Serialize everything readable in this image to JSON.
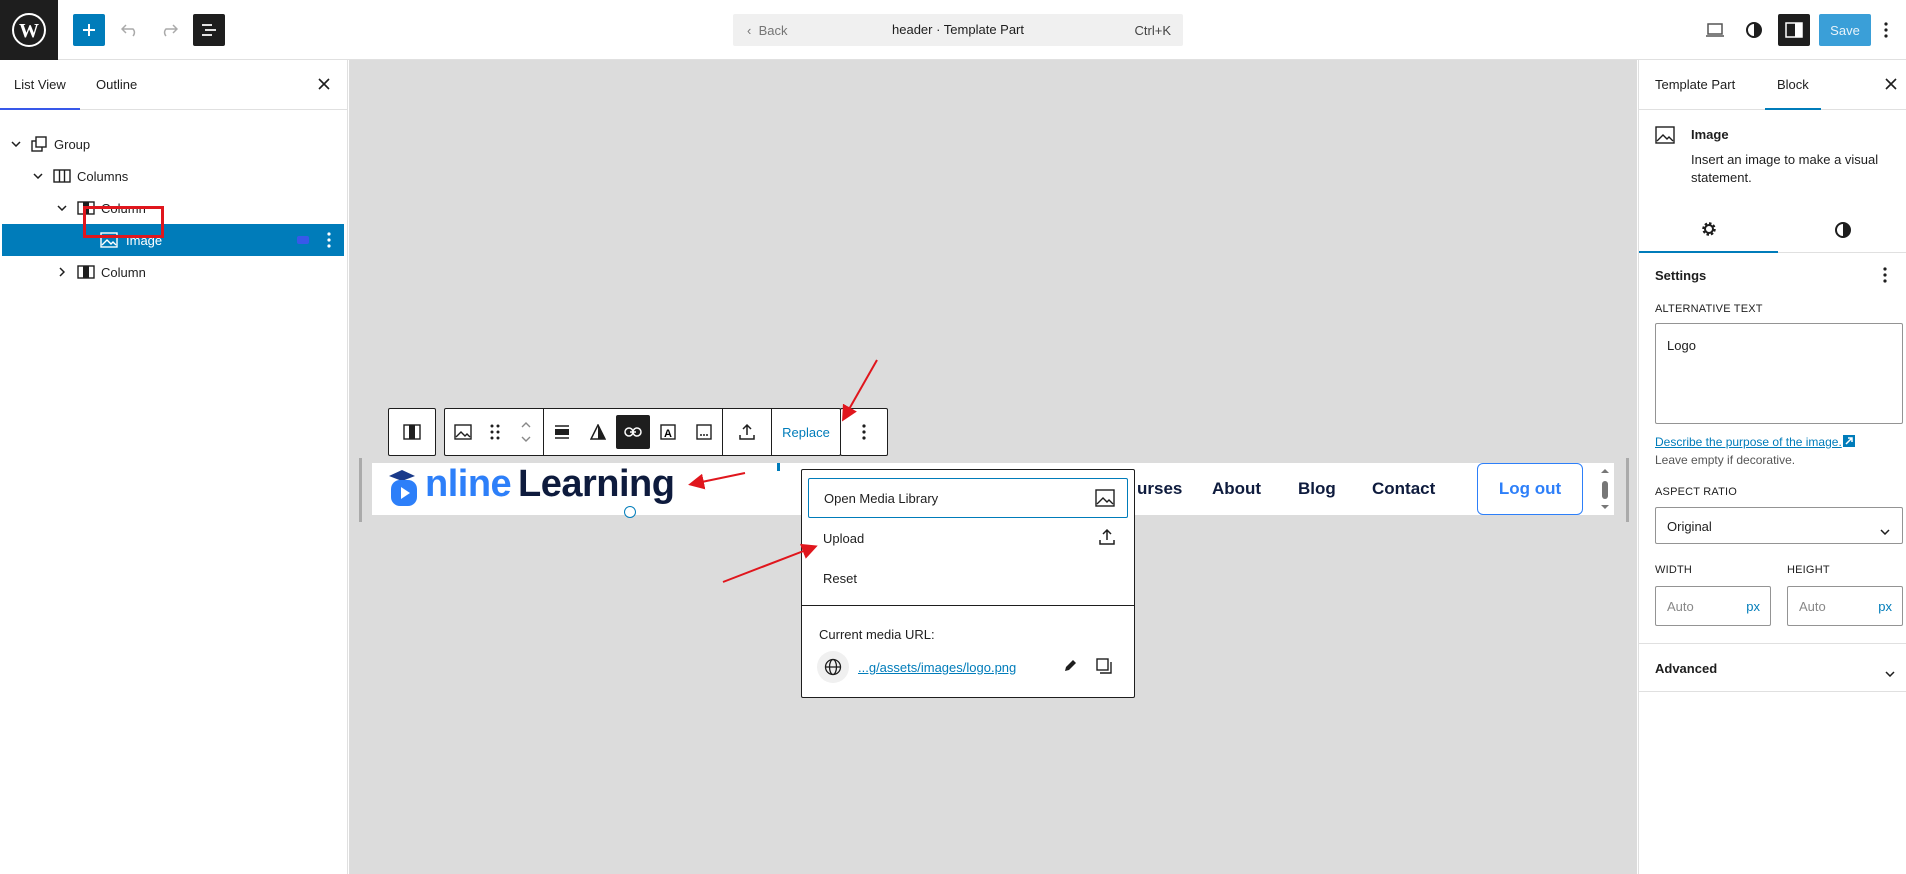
{
  "topbar": {
    "back_label": "Back",
    "title": "header · Template Part",
    "shortcut": "Ctrl+K",
    "save_label": "Save"
  },
  "list_panel": {
    "tabs": [
      "List View",
      "Outline"
    ],
    "tree": [
      {
        "label": "Group",
        "icon": "group-icon"
      },
      {
        "label": "Columns",
        "icon": "columns-icon"
      },
      {
        "label": "Column",
        "icon": "column-icon"
      },
      {
        "label": "Image",
        "icon": "image-icon"
      },
      {
        "label": "Column",
        "icon": "column-icon"
      }
    ]
  },
  "toolbar": {
    "replace_label": "Replace"
  },
  "header_preview": {
    "logo_text_blue": "nline",
    "logo_text_dark": "Learning",
    "nav": [
      "urses",
      "About",
      "Blog",
      "Contact"
    ],
    "logout_label": "Log out"
  },
  "replace_menu": {
    "items": [
      "Open Media Library",
      "Upload",
      "Reset"
    ],
    "current_url_label": "Current media URL:",
    "current_url": "...g/assets/images/logo.png"
  },
  "settings_panel": {
    "tabs": [
      "Template Part",
      "Block"
    ],
    "block_name": "Image",
    "block_description": "Insert an image to make a visual statement.",
    "section_title": "Settings",
    "alt_label": "ALTERNATIVE TEXT",
    "alt_value": "Logo",
    "alt_help_link": "Describe the purpose of the image.",
    "alt_help_text": "Leave empty if decorative.",
    "aspect_label": "ASPECT RATIO",
    "aspect_value": "Original",
    "width_label": "WIDTH",
    "height_label": "HEIGHT",
    "width_placeholder": "Auto",
    "height_placeholder": "Auto",
    "unit": "px",
    "advanced_label": "Advanced"
  },
  "colors": {
    "accent": "#007cba",
    "annotation": "#e0161d"
  }
}
